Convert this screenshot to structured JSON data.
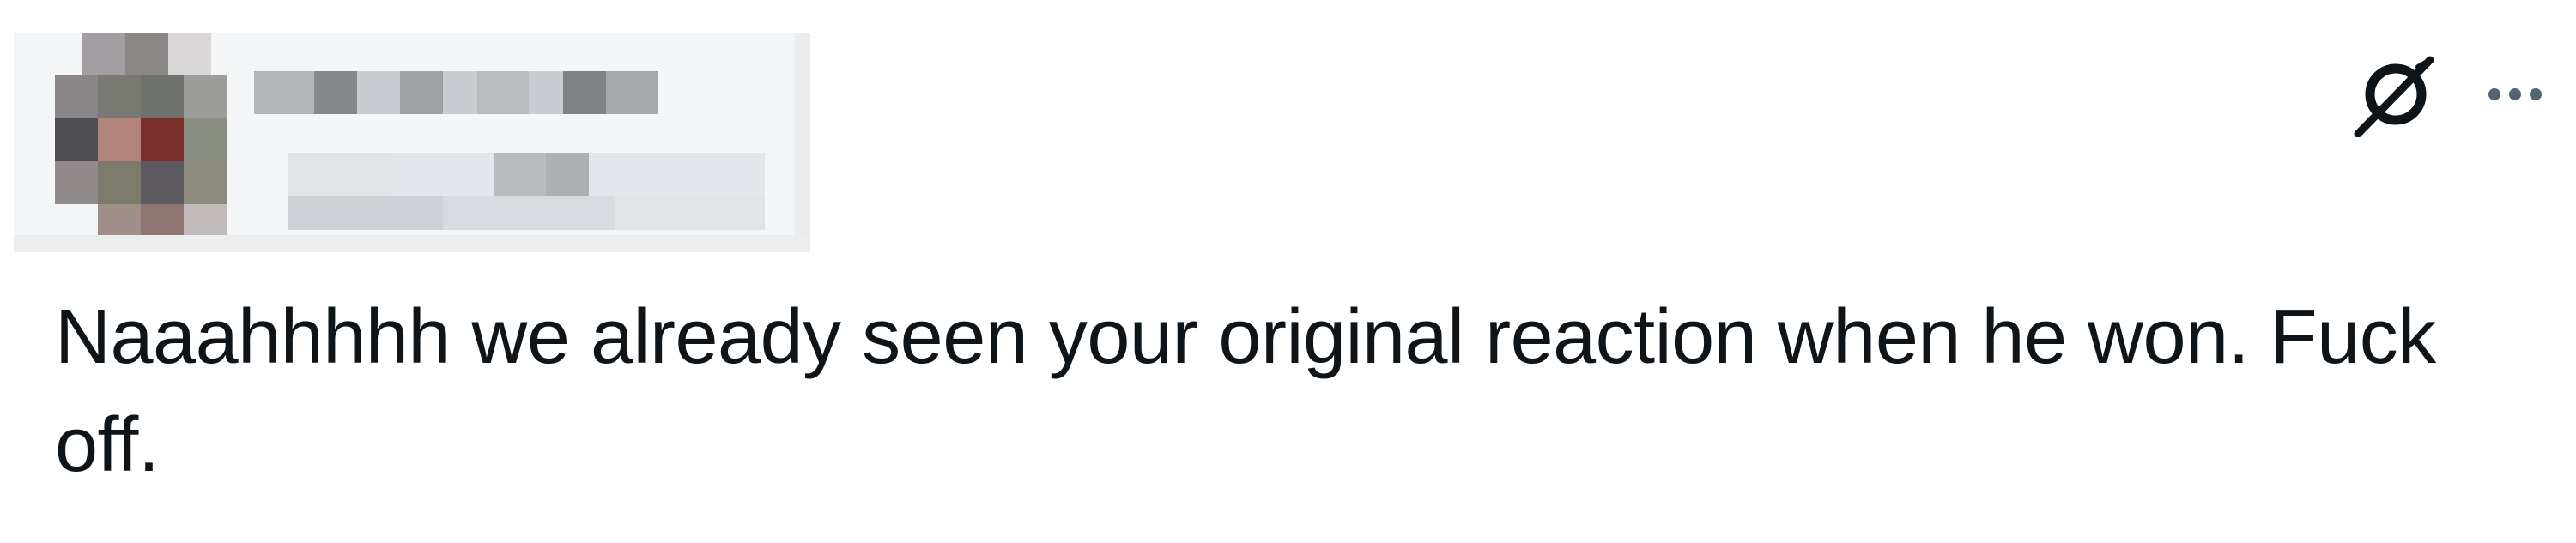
{
  "post": {
    "text": "Naaahhhhh we already seen your original reaction when he won. Fuck\noff."
  },
  "header": {
    "author_redacted": true
  },
  "actions": {
    "grok_icon": "grok-icon",
    "more_icon": "more-horizontal-icon"
  },
  "colors": {
    "text": "#0f1419",
    "icon": "#536471",
    "grok_icon": "#0f1419"
  }
}
